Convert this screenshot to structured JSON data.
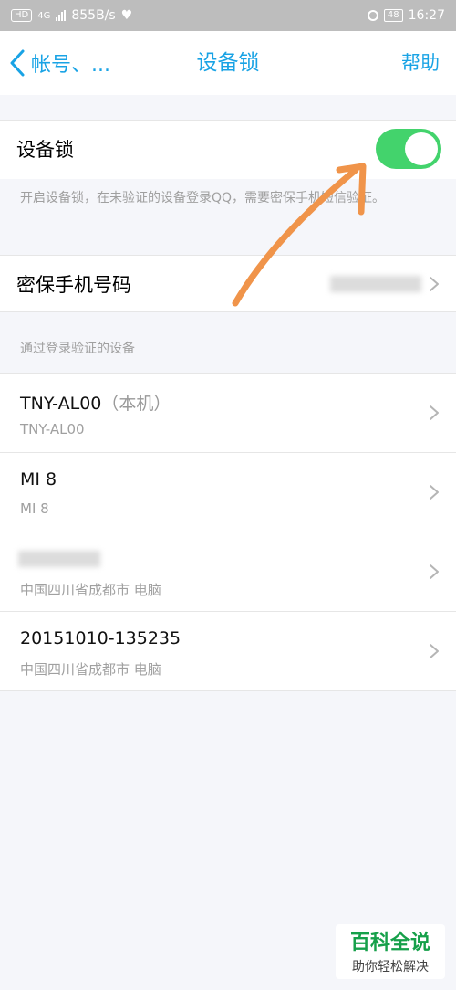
{
  "status_bar": {
    "hd": "HD",
    "net": "4G",
    "speed": "855B/s",
    "battery": "48",
    "time": "16:27",
    "icons": [
      "signal-icon",
      "heart-icon",
      "alarm-icon",
      "battery-icon"
    ]
  },
  "nav": {
    "back_label": "帐号、...",
    "title": "设备锁",
    "help_label": "帮助",
    "accent": "#19a3e5"
  },
  "device_lock": {
    "label": "设备锁",
    "enabled": true,
    "toggle_color": "#43d36c",
    "description": "开启设备锁，在未验证的设备登录QQ，需要密保手机短信验证。"
  },
  "phone": {
    "label": "密保手机号码"
  },
  "devices_section": {
    "header": "通过登录验证的设备",
    "items": [
      {
        "name": "TNY-AL00",
        "tag": "（本机）",
        "sub": "TNY-AL00"
      },
      {
        "name": "MI 8",
        "tag": "",
        "sub": "MI 8"
      },
      {
        "name": "",
        "tag": "",
        "sub": "中国四川省成都市 电脑"
      },
      {
        "name": "20151010-135235",
        "tag": "",
        "sub": "中国四川省成都市 电脑"
      }
    ]
  },
  "watermark": {
    "main": "百科全说",
    "sub": "助你轻松解决"
  }
}
